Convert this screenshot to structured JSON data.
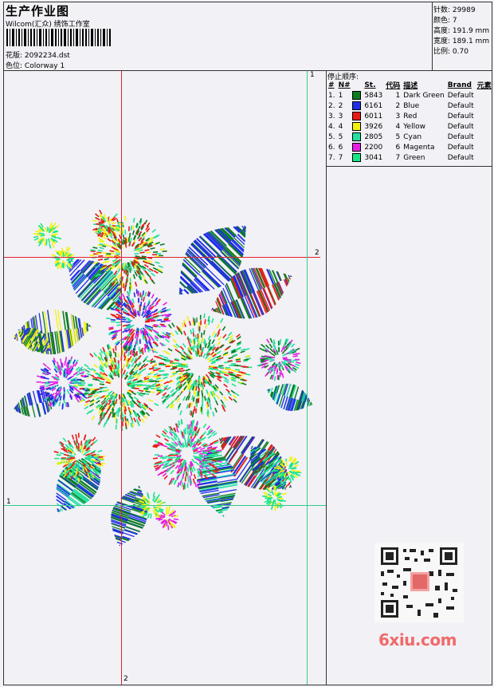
{
  "header": {
    "title": "生产作业图",
    "subtitle": "Wilcom(汇众) 绣饰工作室",
    "design_label": "花版:",
    "design_value": "2092234.dst",
    "colorway_label": "色位:",
    "colorway_value": "Colorway 1"
  },
  "stats": [
    {
      "label": "针数:",
      "value": "29989"
    },
    {
      "label": "颜色:",
      "value": "7"
    },
    {
      "label": "高度:",
      "value": "191.9 mm"
    },
    {
      "label": "宽度:",
      "value": "189.1 mm"
    },
    {
      "label": "比例:",
      "value": "0.70"
    }
  ],
  "stop_table": {
    "title": "停止顺序:",
    "headers": [
      "#",
      "N#",
      "St.",
      "代码",
      "描述",
      "Brand",
      "元素"
    ],
    "rows": [
      {
        "idx": "1.",
        "n": "1",
        "color": "#0a7d1e",
        "st": "5843",
        "code": "1",
        "desc": "Dark Green",
        "brand": "Default"
      },
      {
        "idx": "2.",
        "n": "2",
        "color": "#1f2ee8",
        "st": "6161",
        "code": "2",
        "desc": "Blue",
        "brand": "Default"
      },
      {
        "idx": "3.",
        "n": "3",
        "color": "#e81a14",
        "st": "6011",
        "code": "3",
        "desc": "Red",
        "brand": "Default"
      },
      {
        "idx": "4.",
        "n": "4",
        "color": "#f2f20c",
        "st": "3926",
        "code": "4",
        "desc": "Yellow",
        "brand": "Default"
      },
      {
        "idx": "5.",
        "n": "5",
        "color": "#21e0a0",
        "st": "2805",
        "code": "5",
        "desc": "Cyan",
        "brand": "Default"
      },
      {
        "idx": "6.",
        "n": "6",
        "color": "#e61ee6",
        "st": "2200",
        "code": "6",
        "desc": "Magenta",
        "brand": "Default"
      },
      {
        "idx": "7.",
        "n": "7",
        "color": "#18e688",
        "st": "3041",
        "code": "7",
        "desc": "Green",
        "brand": "Default"
      }
    ]
  },
  "guides": {
    "red_h_label": "2",
    "red_v_label": "2",
    "green_h_label": "1",
    "green_v_label": "1",
    "red_color": "#e0202a",
    "green_color": "#33cc88"
  },
  "watermark": "6xiu.com"
}
